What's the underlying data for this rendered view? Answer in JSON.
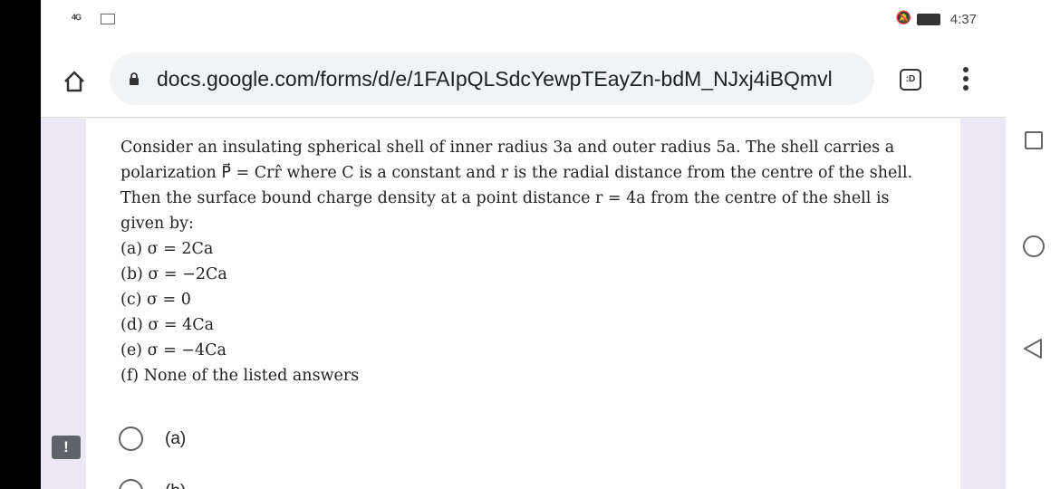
{
  "status_bar": {
    "signal": "4G",
    "time": "4:37",
    "icons": [
      "signal-icon",
      "image-icon",
      "mute-icon",
      "battery-icon"
    ]
  },
  "browser": {
    "url": "docs.google.com/forms/d/e/1FAIpQLSdcYewpTEayZn-bdM_NJxj4iBQmvl",
    "tabs_label": ":D"
  },
  "question": {
    "lines": [
      "Consider an insulating spherical shell of inner radius 3a and outer radius 5a. The shell carries a polarization P⃗ = Crr̂ where C is a constant and r is the radial distance from the centre of the shell. Then the surface bound charge density at a point distance r = 4a from the centre of the shell is given by:"
    ],
    "options": [
      "(a) σ = 2Ca",
      "(b) σ = −2Ca",
      "(c) σ = 0",
      "(d) σ = 4Ca",
      "(e) σ = −4Ca",
      "(f) None of the listed answers"
    ]
  },
  "choices": [
    "(a)",
    "(b)"
  ],
  "feedback_icon": "!"
}
